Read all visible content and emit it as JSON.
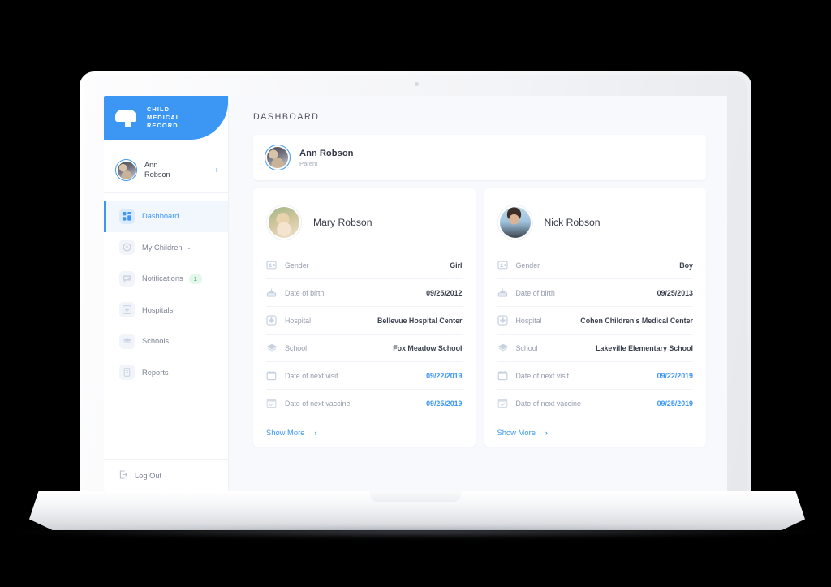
{
  "brand": {
    "line1": "CHILD",
    "line2": "MEDICAL",
    "line3": "RECORD",
    "logo_icon": "heart-cross-icon",
    "color": "#3b97f3"
  },
  "sidebar": {
    "profile": {
      "name_line1": "Ann",
      "name_line2": "Robson",
      "avatar_icon": "avatar",
      "chevron_icon": "chevron-right-icon"
    },
    "items": [
      {
        "label": "Dashboard",
        "icon": "grid-icon",
        "active": true
      },
      {
        "label": "My Children",
        "icon": "children-icon",
        "active": false,
        "caret": "⌄"
      },
      {
        "label": "Notifications",
        "icon": "chat-icon",
        "active": false,
        "badge": "1"
      },
      {
        "label": "Hospitals",
        "icon": "hospital-cross-icon",
        "active": false
      },
      {
        "label": "Schools",
        "icon": "graduation-cap-icon",
        "active": false
      },
      {
        "label": "Reports",
        "icon": "document-icon",
        "active": false
      }
    ],
    "logout": {
      "label": "Log Out",
      "icon": "logout-icon"
    },
    "badge_color": "#55bf79",
    "badge_bg": "#e4f7ea"
  },
  "main": {
    "page_title": "DASHBOARD",
    "owner": {
      "name": "Ann Robson",
      "role": "Parent",
      "avatar_icon": "avatar"
    },
    "children": [
      {
        "name": "Mary Robson",
        "avatar_icon": "avatar-girl",
        "show_more": "Show More",
        "show_more_chevron": "›",
        "rows": [
          {
            "label": "Gender",
            "value": "Girl",
            "icon": "id-card-icon",
            "accent": false
          },
          {
            "label": "Date of birth",
            "value": "09/25/2012",
            "icon": "birthday-cake-icon",
            "accent": false
          },
          {
            "label": "Hospital",
            "value": "Bellevue Hospital Center",
            "icon": "hospital-cross-icon",
            "accent": false
          },
          {
            "label": "School",
            "value": "Fox Meadow School",
            "icon": "graduation-cap-icon",
            "accent": false
          },
          {
            "label": "Date of next visit",
            "value": "09/22/2019",
            "icon": "calendar-icon",
            "accent": true
          },
          {
            "label": "Date of next vaccine",
            "value": "09/25/2019",
            "icon": "calendar-check-icon",
            "accent": true
          }
        ]
      },
      {
        "name": "Nick Robson",
        "avatar_icon": "avatar-boy",
        "show_more": "Show More",
        "show_more_chevron": "›",
        "rows": [
          {
            "label": "Gender",
            "value": "Boy",
            "icon": "id-card-icon",
            "accent": false
          },
          {
            "label": "Date of birth",
            "value": "09/25/2013",
            "icon": "birthday-cake-icon",
            "accent": false
          },
          {
            "label": "Hospital",
            "value": "Cohen Children's Medical Center",
            "icon": "hospital-cross-icon",
            "accent": false
          },
          {
            "label": "School",
            "value": "Lakeville Elementary School",
            "icon": "graduation-cap-icon",
            "accent": false
          },
          {
            "label": "Date of next visit",
            "value": "09/22/2019",
            "icon": "calendar-icon",
            "accent": true
          },
          {
            "label": "Date of next vaccine",
            "value": "09/25/2019",
            "icon": "calendar-check-icon",
            "accent": true
          }
        ]
      }
    ]
  },
  "theme": {
    "accent": "#3b97f3",
    "page_bg": "#f7f9fc",
    "card_bg": "#ffffff",
    "muted_text": "#949cac",
    "dark_text": "#353b49"
  }
}
